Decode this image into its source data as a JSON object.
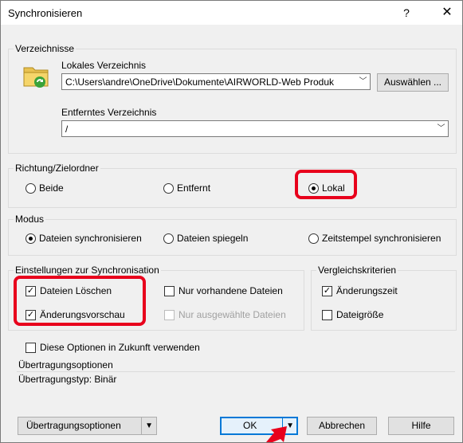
{
  "window": {
    "title": "Synchronisieren",
    "help_glyph": "?",
    "close_glyph": "✕"
  },
  "verzeichnisse": {
    "label": "Verzeichnisse",
    "local_label": "Lokales Verzeichnis",
    "local_value": "C:\\Users\\andre\\OneDrive\\Dokumente\\AIRWORLD-Web Produk",
    "browse_button": "Auswählen ...",
    "remote_label": "Entferntes Verzeichnis",
    "remote_value": "/"
  },
  "richtung": {
    "label": "Richtung/Zielordner",
    "options": [
      "Beide",
      "Entfernt",
      "Lokal"
    ],
    "selected": "Lokal"
  },
  "modus": {
    "label": "Modus",
    "options": [
      "Dateien synchronisieren",
      "Dateien spiegeln",
      "Zeitstempel synchronisieren"
    ],
    "selected": "Dateien synchronisieren"
  },
  "einstellungen": {
    "label": "Einstellungen zur Synchronisation",
    "delete_files": {
      "label": "Dateien Löschen",
      "checked": true
    },
    "change_preview": {
      "label": "Änderungsvorschau",
      "checked": true
    },
    "only_existing": {
      "label": "Nur vorhandene Dateien",
      "checked": false
    },
    "only_selected": {
      "label": "Nur ausgewählte Dateien",
      "checked": false,
      "disabled": true
    }
  },
  "vergleich": {
    "label": "Vergleichskriterien",
    "mod_time": {
      "label": "Änderungszeit",
      "checked": true
    },
    "file_size": {
      "label": "Dateigröße",
      "checked": false
    }
  },
  "future": {
    "label": "Diese Optionen in Zukunft verwenden",
    "checked": false
  },
  "transfer": {
    "label": "Übertragungsoptionen",
    "type_text": "Übertragungstyp: Binär"
  },
  "buttons": {
    "transfer_options": "Übertragungsoptionen",
    "ok": "OK",
    "cancel": "Abbrechen",
    "help": "Hilfe"
  },
  "colors": {
    "highlight": "#e8001c",
    "dialog_bg": "#f0f0f0"
  }
}
